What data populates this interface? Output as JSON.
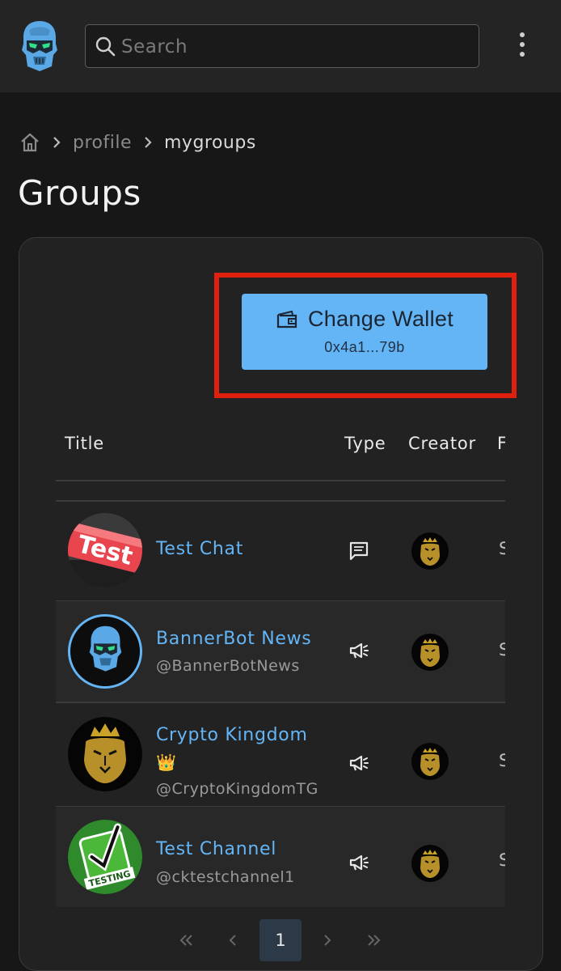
{
  "search": {
    "placeholder": "Search",
    "value": ""
  },
  "breadcrumb": {
    "items": [
      "profile",
      "mygroups"
    ]
  },
  "page": {
    "title": "Groups"
  },
  "wallet": {
    "label": "Change Wallet",
    "address": "0x4a1...79b",
    "button_color": "#64b5f6"
  },
  "table": {
    "columns": [
      "Title",
      "Type",
      "Creator",
      "F"
    ],
    "cut_char": "S",
    "rows": [
      {
        "name": "Test Chat",
        "handle": "",
        "type_icon": "chat-icon",
        "avatar": "test-badge"
      },
      {
        "name": "BannerBot News",
        "handle": "@BannerBotNews",
        "type_icon": "megaphone-icon",
        "avatar": "bannerbot-logo"
      },
      {
        "name": "Crypto Kingdom",
        "emoji": "👑",
        "handle": "@CryptoKingdomTG",
        "type_icon": "megaphone-icon",
        "avatar": "lion-crown"
      },
      {
        "name": "Test Channel",
        "handle": "@cktestchannel1",
        "type_icon": "megaphone-icon",
        "avatar": "testing-checkbox"
      }
    ]
  },
  "pagination": {
    "current": "1"
  },
  "colors": {
    "accent": "#64b5f6",
    "highlight": "#e0200f",
    "background": "#171717",
    "card": "#222222"
  }
}
